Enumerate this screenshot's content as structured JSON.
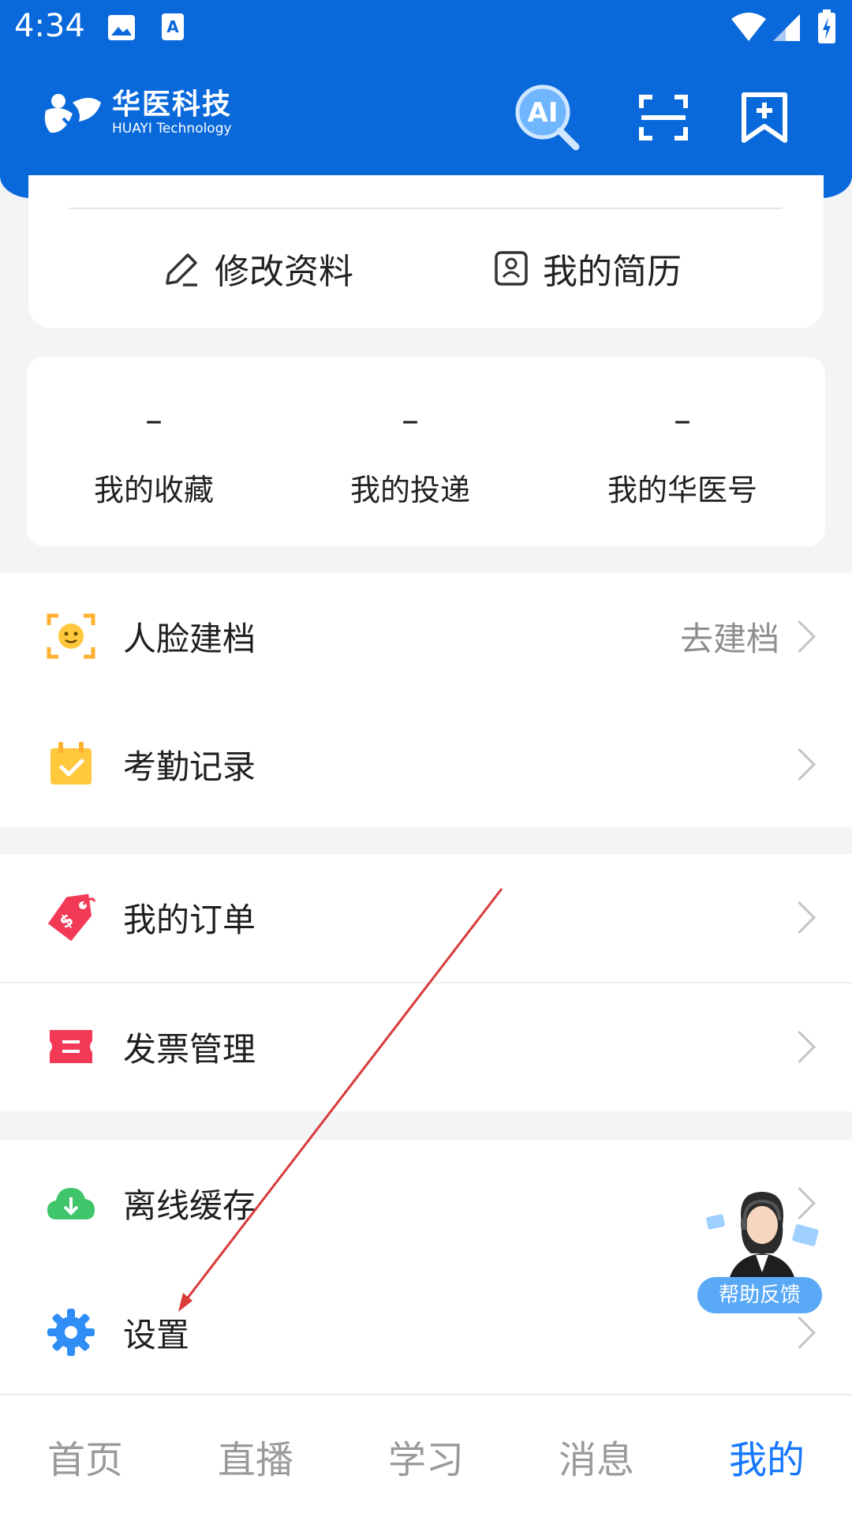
{
  "status_bar": {
    "time": "4:34"
  },
  "header": {
    "logo_name": "华医科技",
    "logo_sub": "HUAYI Technology",
    "ai_icon_text": "AI"
  },
  "profile_actions": {
    "edit_profile": "修改资料",
    "my_resume": "我的简历"
  },
  "stats": [
    {
      "value": "–",
      "label": "我的收藏"
    },
    {
      "value": "–",
      "label": "我的投递"
    },
    {
      "value": "–",
      "label": "我的华医号"
    }
  ],
  "menu": {
    "face_record": {
      "label": "人脸建档",
      "trail": "去建档"
    },
    "attendance": {
      "label": "考勤记录"
    },
    "orders": {
      "label": "我的订单"
    },
    "invoice": {
      "label": "发票管理"
    },
    "offline_cache": {
      "label": "离线缓存"
    },
    "settings": {
      "label": "设置"
    }
  },
  "help": {
    "label": "帮助反馈"
  },
  "bottom_nav": [
    {
      "label": "首页"
    },
    {
      "label": "直播"
    },
    {
      "label": "学习"
    },
    {
      "label": "消息"
    },
    {
      "label": "我的"
    }
  ],
  "colors": {
    "brand_blue": "#0969db",
    "active_tab": "#1677ff",
    "annotation": "#d93a3a"
  }
}
